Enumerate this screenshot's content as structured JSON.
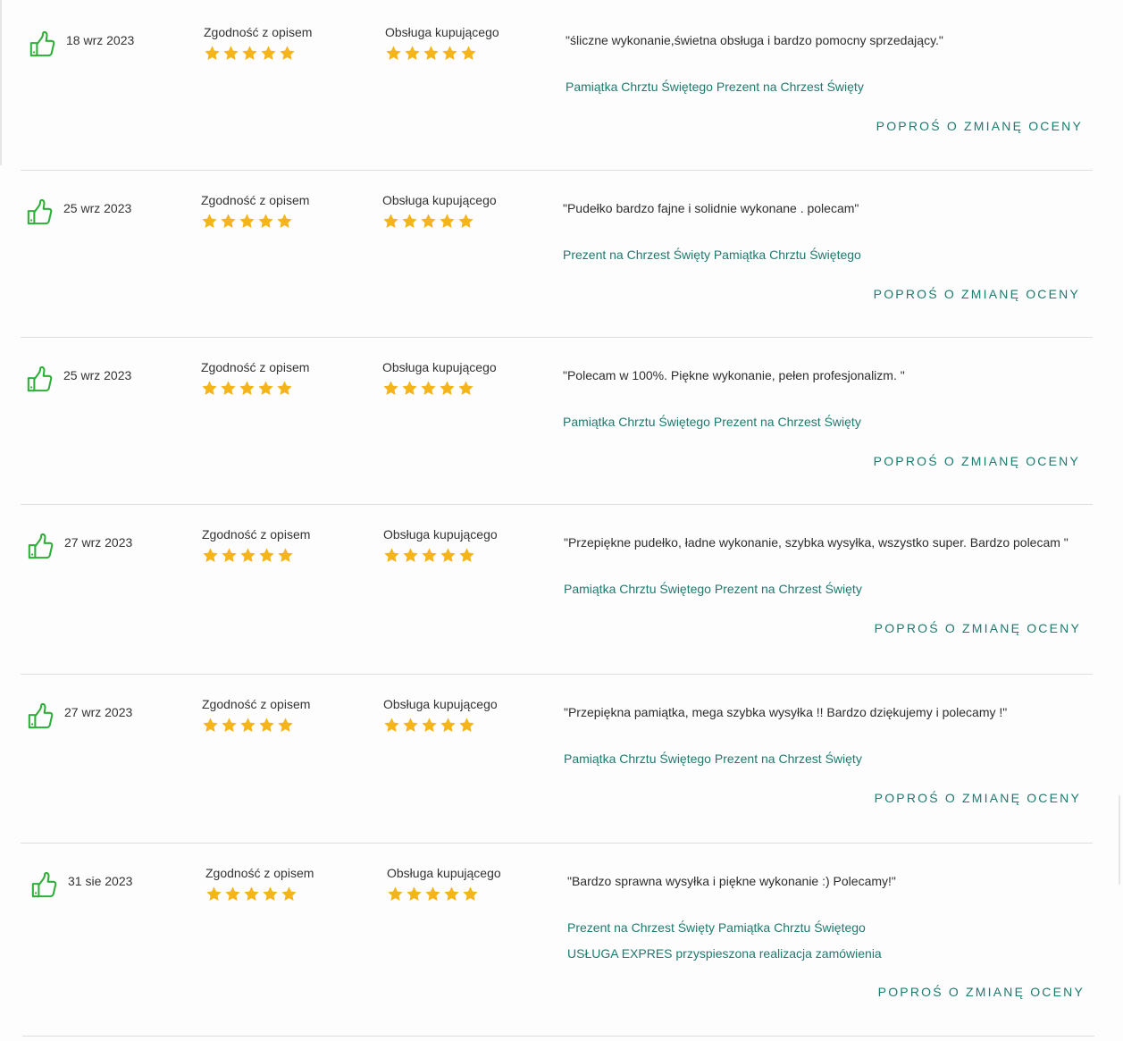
{
  "colors": {
    "accent": "#1d7a6e",
    "thumb": "#2fae3a",
    "star": "#f4b41a",
    "divider": "#dedede"
  },
  "reviews": [
    {
      "date": "18 wrz 2023",
      "ratings": [
        {
          "label": "Zgodność z opisem",
          "stars": 5
        },
        {
          "label": "Obsługa kupującego",
          "stars": 5
        }
      ],
      "comment": "\"śliczne wykonanie,świetna obsługa i bardzo pomocny sprzedający.\"",
      "offers": [
        "Pamiątka Chrztu Świętego Prezent na Chrzest Święty"
      ],
      "action": "POPROŚ O ZMIANĘ OCENY"
    },
    {
      "date": "25 wrz 2023",
      "ratings": [
        {
          "label": "Zgodność z opisem",
          "stars": 5
        },
        {
          "label": "Obsługa kupującego",
          "stars": 5
        }
      ],
      "comment": "\"Pudełko bardzo fajne i solidnie wykonane . polecam\"",
      "offers": [
        "Prezent na Chrzest Święty Pamiątka Chrztu Świętego"
      ],
      "action": "POPROŚ O ZMIANĘ OCENY"
    },
    {
      "date": "25 wrz 2023",
      "ratings": [
        {
          "label": "Zgodność z opisem",
          "stars": 5
        },
        {
          "label": "Obsługa kupującego",
          "stars": 5
        }
      ],
      "comment": "\"Polecam w 100%. Piękne wykonanie, pełen profesjonalizm. \"",
      "offers": [
        "Pamiątka Chrztu Świętego Prezent na Chrzest Święty"
      ],
      "action": "POPROŚ O ZMIANĘ OCENY"
    },
    {
      "date": "27 wrz 2023",
      "ratings": [
        {
          "label": "Zgodność z opisem",
          "stars": 5
        },
        {
          "label": "Obsługa kupującego",
          "stars": 5
        }
      ],
      "comment": "\"Przepiękne pudełko, ładne wykonanie, szybka wysyłka, wszystko super. Bardzo polecam \"",
      "offers": [
        "Pamiątka Chrztu Świętego Prezent na Chrzest Święty"
      ],
      "action": "POPROŚ O ZMIANĘ OCENY"
    },
    {
      "date": "27 wrz 2023",
      "ratings": [
        {
          "label": "Zgodność z opisem",
          "stars": 5
        },
        {
          "label": "Obsługa kupującego",
          "stars": 5
        }
      ],
      "comment": "\"Przepiękna pamiątka, mega szybka wysyłka !! Bardzo dziękujemy i polecamy !\"",
      "offers": [
        "Pamiątka Chrztu Świętego Prezent na Chrzest Święty"
      ],
      "action": "POPROŚ O ZMIANĘ OCENY"
    },
    {
      "date": "31 sie 2023",
      "ratings": [
        {
          "label": "Zgodność z opisem",
          "stars": 5
        },
        {
          "label": "Obsługa kupującego",
          "stars": 5
        }
      ],
      "comment": "\"Bardzo sprawna wysyłka i piękne wykonanie :) Polecamy!\"",
      "offers": [
        "Prezent na Chrzest Święty Pamiątka Chrztu Świętego",
        "USŁUGA EXPRES przyspieszona realizacja zamówienia"
      ],
      "action": "POPROŚ O ZMIANĘ OCENY"
    }
  ]
}
